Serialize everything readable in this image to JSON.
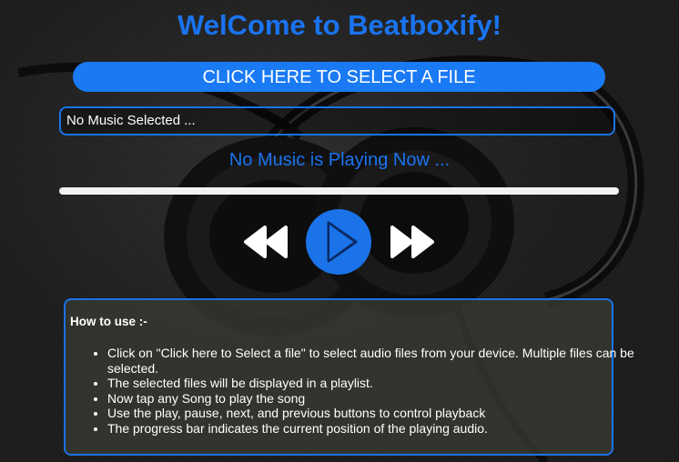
{
  "header": {
    "title": "WelCome to Beatboxify!"
  },
  "file_picker": {
    "button_label": "CLICK HERE TO SELECT A FILE",
    "selected_text": "No Music Selected ..."
  },
  "player": {
    "status_text": "No Music is Playing Now ...",
    "progress": 0,
    "prev_icon": "rewind-icon",
    "play_icon": "play-icon",
    "next_icon": "fast-forward-icon"
  },
  "howto": {
    "title": "How to use :-",
    "items": [
      "Click on \"Click here to Select a file\" to select audio files from your device. Multiple files can be selected.",
      "The selected files will be displayed in a playlist.",
      "Now tap any Song to play the song",
      "Use the play, pause, next, and previous buttons to control playback",
      "The progress bar indicates the current position of the playing audio."
    ]
  },
  "colors": {
    "accent": "#1a73e8",
    "title": "#1a73f0",
    "background": "#1d1d1d",
    "panel": "#3a3a32"
  },
  "background_image": "headphones-photo"
}
